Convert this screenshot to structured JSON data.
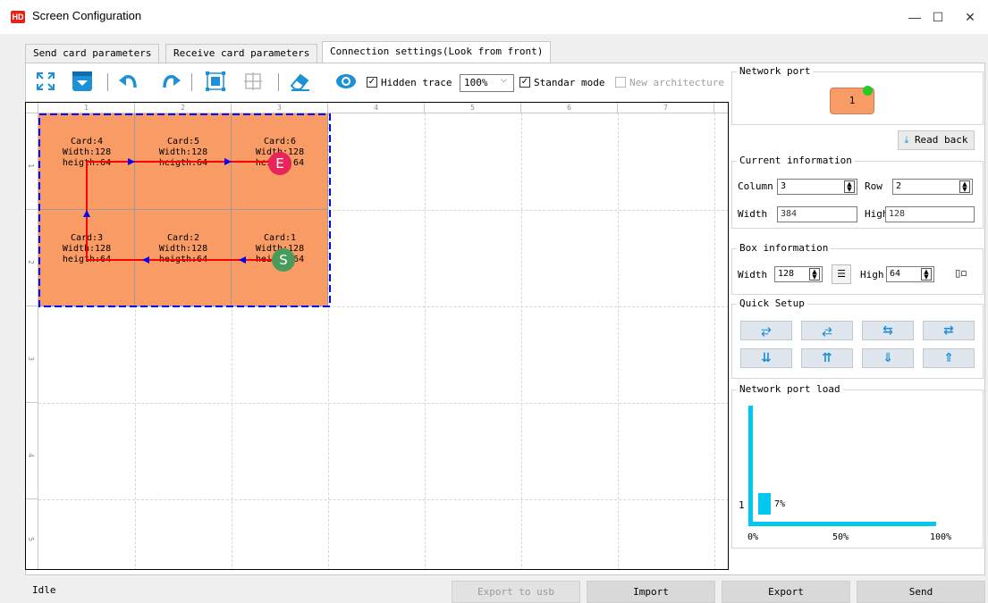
{
  "window": {
    "logo": "HD",
    "title": "Screen Configuration",
    "minimize": "—",
    "maximize": "☐",
    "close": "✕"
  },
  "tabs": [
    {
      "label": "Send card parameters",
      "active": false
    },
    {
      "label": "Receive card parameters",
      "active": false
    },
    {
      "label": "Connection settings(Look from front)",
      "active": true
    }
  ],
  "toolbar": {
    "icons": [
      "fullscreen-icon",
      "download-icon",
      "undo-icon",
      "redo-icon",
      "select-box-icon",
      "grid-select-icon",
      "eraser-icon",
      "eye-icon"
    ],
    "hidden_trace": {
      "label": "Hidden trace",
      "checked": true
    },
    "zoom": "100%",
    "standard_mode": {
      "label": "Standar mode",
      "checked": true
    },
    "new_architecture": {
      "label": "New architecture",
      "checked": false,
      "disabled": true
    }
  },
  "grid": {
    "columns": [
      "1",
      "2",
      "3",
      "4",
      "5",
      "6",
      "7"
    ],
    "rows": [
      "1",
      "2",
      "3",
      "4",
      "5"
    ],
    "cards": [
      {
        "card": "Card:4",
        "width": "Width:128",
        "height": "heigth:64"
      },
      {
        "card": "Card:5",
        "width": "Width:128",
        "height": "heigth:64"
      },
      {
        "card": "Card:6",
        "width": "Width:128",
        "height": "heigth:64"
      },
      {
        "card": "Card:3",
        "width": "Width:128",
        "height": "heigth:64"
      },
      {
        "card": "Card:2",
        "width": "Width:128",
        "height": "heigth:64"
      },
      {
        "card": "Card:1",
        "width": "Width:128",
        "height": "heigth:64"
      }
    ],
    "start_marker": "S",
    "end_marker": "E",
    "colors": {
      "card": "#f89b64",
      "trace": "#ff0000",
      "arrow": "#0000ff",
      "border": "#0000ff",
      "start": "#4a9a5c",
      "end": "#e8245a"
    }
  },
  "network_port": {
    "title": "Network port",
    "port": "1"
  },
  "read_back": "Read back",
  "current_info": {
    "title": "Current information",
    "column_label": "Column",
    "column": "3",
    "row_label": "Row",
    "row": "2",
    "width_label": "Width",
    "width": "384",
    "high_label": "High",
    "high": "128"
  },
  "box_info": {
    "title": "Box information",
    "width_label": "Width",
    "width": "128",
    "high_label": "High",
    "high": "64"
  },
  "quick_setup": {
    "title": "Quick Setup",
    "buttons": [
      "⥂",
      "⥄",
      "⇆",
      "⇄",
      "⇊",
      "⇈",
      "⇓",
      "⇑"
    ]
  },
  "network_load": {
    "title": "Network port load",
    "port": "1",
    "value_label": "7%",
    "value": 7,
    "ticks": [
      "0%",
      "50%",
      "100%"
    ]
  },
  "status": "Idle",
  "buttons": {
    "export_usb": "Export to usb",
    "import": "Import",
    "export": "Export",
    "send": "Send"
  }
}
